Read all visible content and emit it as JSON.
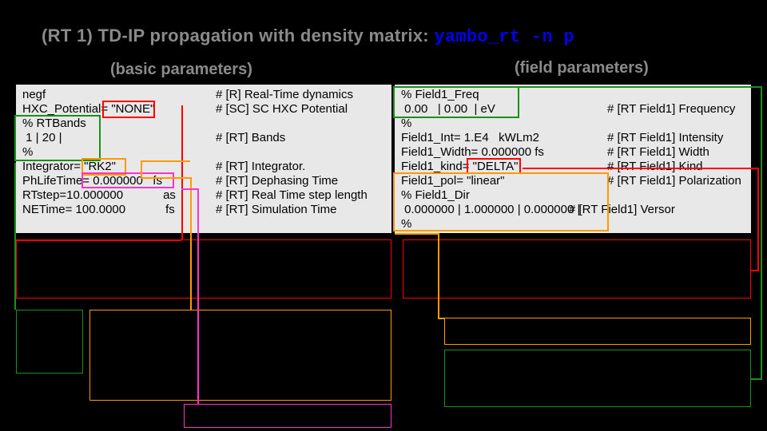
{
  "title": {
    "prefix": "(RT 1) TD-IP propagation with density matrix:  ",
    "command": "yambo_rt -n p"
  },
  "subheaders": {
    "basic": "(basic parameters)",
    "field": "(field parameters)"
  },
  "left_panel": {
    "l1a": "negf",
    "l1c": "# [R] Real-Time dynamics",
    "l2a": "HXC_Potential=",
    "l2v": " \"NONE\"",
    "l2c": "# [SC] SC HXC Potential",
    "l3": "% RTBands",
    "l4": " 1 | 20 |",
    "l4c": "# [RT] Bands",
    "l5": "%",
    "l6a": "Integrator=",
    "l6v": " \"RK2\"",
    "l6c": "# [RT] Integrator.",
    "l7a": "PhLifeTime=",
    "l7v": " 0.000000   fs",
    "l7c": "# [RT] Dephasing Time",
    "l8a": "RTstep=10.000000            as",
    "l8c": "# [RT] Real Time step length",
    "l9a": "NETime= 100.0000            fs",
    "l9c": "# [RT] Simulation Time"
  },
  "right_panel": {
    "r1": "% Field1_Freq",
    "r2": " 0.00   | 0.00  | eV",
    "r2c": "# [RT Field1] Frequency",
    "r3": "%",
    "r4": "Field1_Int= 1.E4   kWLm2",
    "r4c": "# [RT Field1] Intensity",
    "r5": "Field1_Width= 0.000000 fs",
    "r5c": "# [RT Field1] Width",
    "r6a": "Field1_kind=",
    "r6v": " \"DELTA\"",
    "r6c": "# [RT Field1] Kind",
    "r7": "Field1_pol= \"linear\"",
    "r7c": "# [RT Field1] Polarization",
    "r8": "% Field1_Dir",
    "r9": " 0.000000 | 1.000000 | 0.000000 |",
    "r9c": "# [RT Field1] Versor",
    "r10": "%"
  }
}
